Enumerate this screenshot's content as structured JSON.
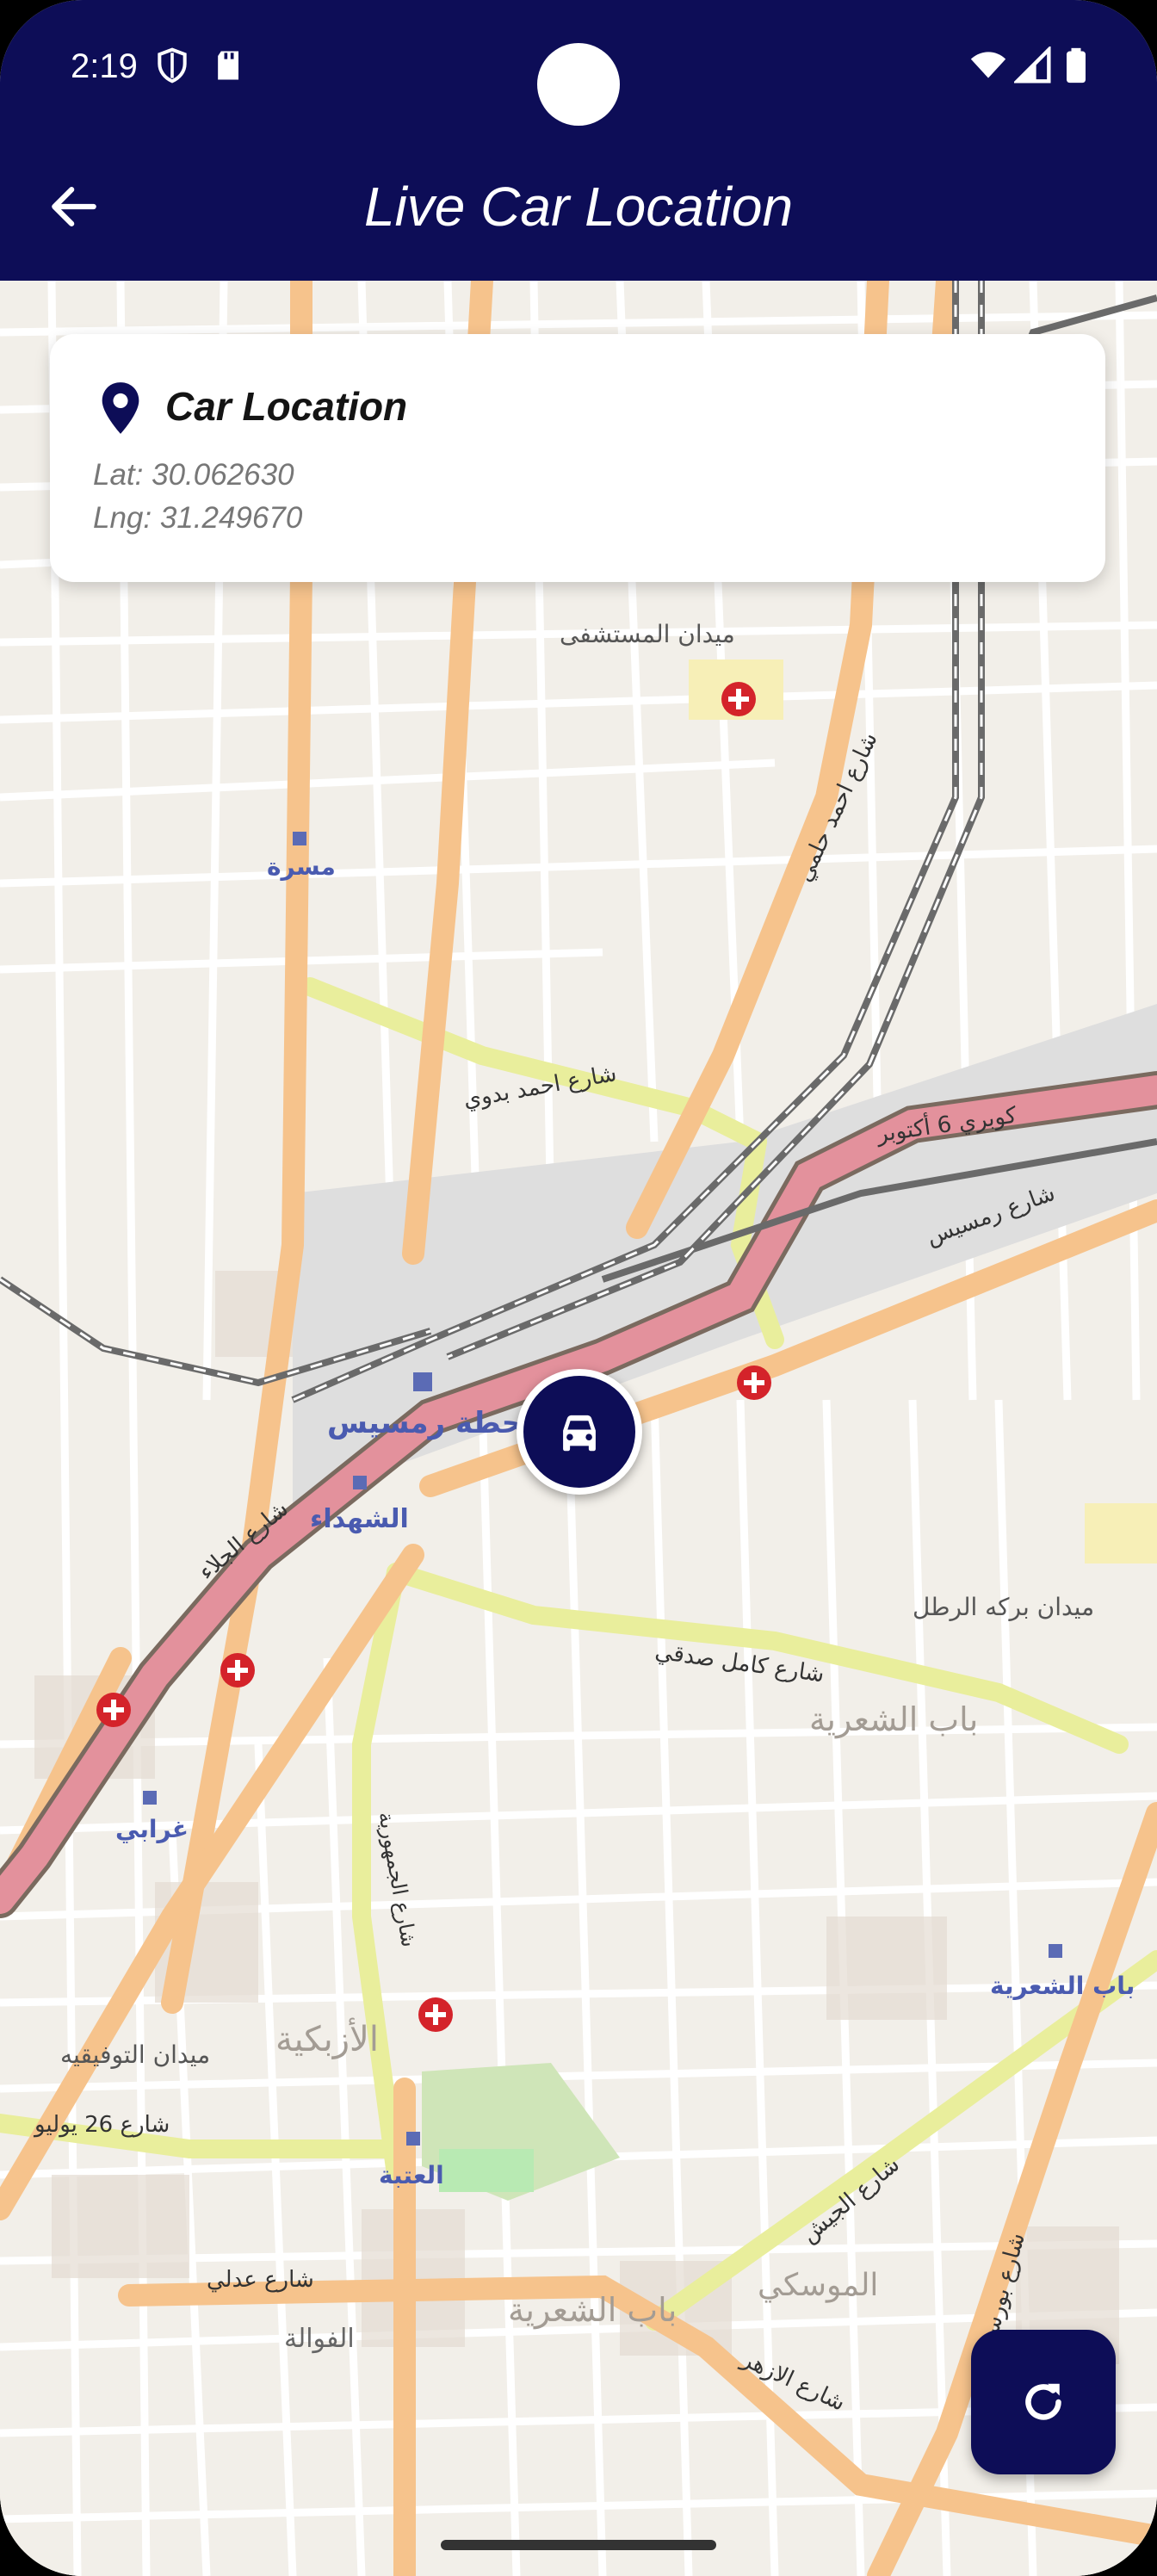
{
  "status_bar": {
    "time": "2:19",
    "icons": [
      "shield-icon",
      "sd-card-icon",
      "wifi-icon",
      "signal-icon",
      "battery-icon"
    ]
  },
  "app_bar": {
    "title": "Live Car Location",
    "back_icon": "arrow-back-icon"
  },
  "location_card": {
    "icon": "location-pin-icon",
    "title": "Car Location",
    "lat": "Lat: 30.062630",
    "lng": "Lng: 31.249670"
  },
  "map": {
    "labels": {
      "ramses_station": "محطة رمسيس",
      "shohada": "الشهداء",
      "masarra": "مسرة",
      "ghamra": "غرابي",
      "ataba": "العتبة",
      "bab_shaaria_station": "باب الشعرية",
      "azbakeya": "الأزبكية",
      "bab_shaaria": "باب الشعرية",
      "mosky": "الموسكي",
      "fawala": "الفوالة",
      "raml": "ميدان بركه الرطل",
      "tawfikeya": "ميدان التوفيقيه",
      "street_26_july": "شارع 26 يوليو",
      "kobry_6_october": "كوبري 6 أكتوبر",
      "ramses_street": "شارع رمسيس",
      "ahmed_helmy": "شارع احمد حلمي",
      "ahmed_badawy": "شارع احمد بدوي",
      "kamel_sedky": "شارع كامل صدقي",
      "gomhoreya": "شارع الجمهورية",
      "gaish": "شارع الجيش",
      "port_said": "شارع بورسعيد",
      "azhar": "شارع الازهر",
      "adly": "شارع عدلي",
      "galaa": "شارع الجلاء",
      "mostashfa": "ميدان المستشفى"
    }
  },
  "marker": {
    "icon": "car-icon"
  },
  "fab": {
    "icon": "refresh-icon"
  },
  "colors": {
    "primary": "#0d0d57",
    "map_bg": "#f2efe9",
    "primary_road": "#f7c58b",
    "secondary_road": "#f0f3a8",
    "bridge": "#e3919c",
    "rail": "#6a6a6a",
    "hospital": "#d4232a"
  }
}
